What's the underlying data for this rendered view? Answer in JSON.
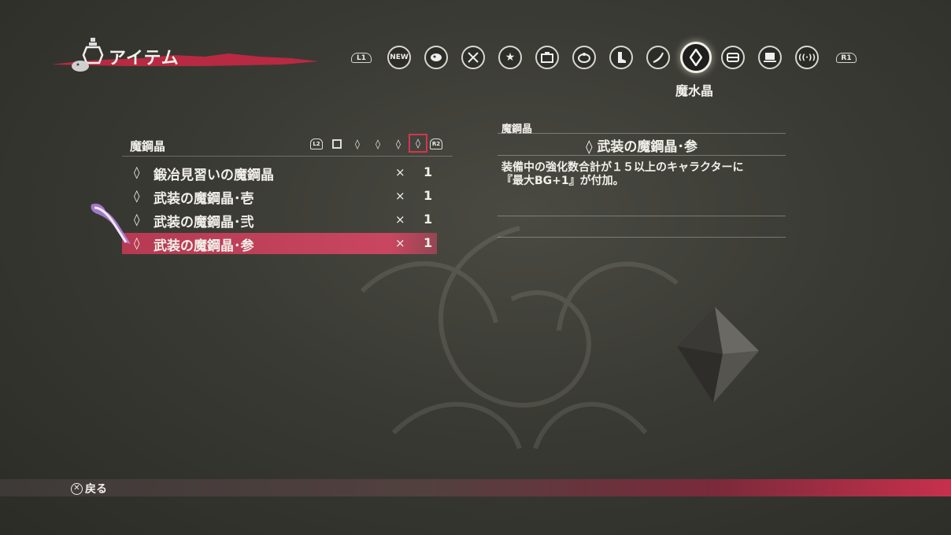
{
  "header": {
    "title": "アイテム"
  },
  "tabs": {
    "left_shoulder": "L1",
    "right_shoulder": "R1",
    "new_label": "NEW",
    "items": [
      {
        "icon": "new-icon"
      },
      {
        "icon": "food-icon"
      },
      {
        "icon": "weapon-icon"
      },
      {
        "icon": "star-icon"
      },
      {
        "icon": "chest-icon"
      },
      {
        "icon": "accessory-icon"
      },
      {
        "icon": "boot-icon"
      },
      {
        "icon": "horn-icon"
      },
      {
        "icon": "crystal-icon",
        "active": true
      },
      {
        "icon": "treasure-icon"
      },
      {
        "icon": "book-icon"
      },
      {
        "icon": "signal-icon"
      }
    ],
    "active_label": "魔水晶"
  },
  "list": {
    "title": "魔鋼晶",
    "subtab_left": "L2",
    "subtab_right": "R2",
    "items": [
      {
        "name": "鍛冶見習いの魔鋼晶",
        "x": "×",
        "qty": "1"
      },
      {
        "name": "武装の魔鋼晶･壱",
        "x": "×",
        "qty": "1"
      },
      {
        "name": "武装の魔鋼晶･弐",
        "x": "×",
        "qty": "1"
      },
      {
        "name": "武装の魔鋼晶･参",
        "x": "×",
        "qty": "1",
        "selected": true
      }
    ]
  },
  "detail": {
    "category": "魔鋼晶",
    "name": "武装の魔鋼晶･参",
    "description": "装備中の強化数合計が１５以上のキャラクターに\n『最大BG+1』が付加。"
  },
  "footer": {
    "button_symbol": "✕",
    "back_label": "戻る"
  },
  "colors": {
    "accent": "#c94660",
    "selected_frame": "#d6354f"
  }
}
